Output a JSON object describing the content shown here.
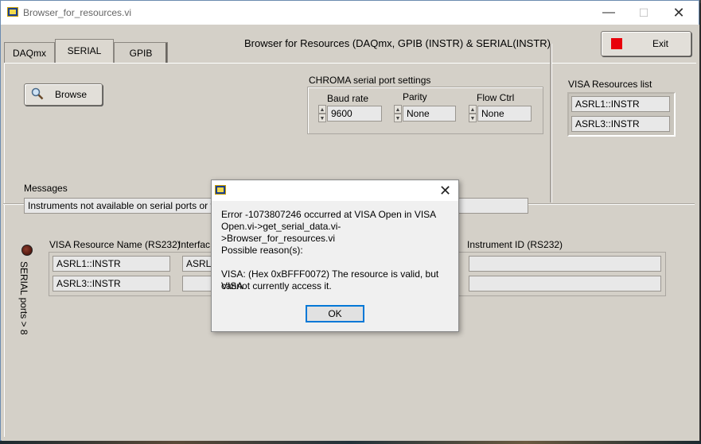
{
  "window": {
    "title": "Browser_for_resources.vi",
    "controls": {
      "minimize": "—",
      "maximize": "☐",
      "close": "✕"
    }
  },
  "header": {
    "title": "Browser for Resources (DAQmx, GPIB (INSTR) & SERIAL(INSTR)",
    "exit_label": "Exit"
  },
  "tabs": [
    {
      "label": "DAQmx",
      "active": false
    },
    {
      "label": "SERIAL",
      "active": true
    },
    {
      "label": "GPIB",
      "active": false
    }
  ],
  "serial": {
    "browse_label": "Browse",
    "chroma": {
      "title": "CHROMA serial port settings",
      "baud_label": "Baud rate",
      "baud_value": "9600",
      "parity_label": "Parity",
      "parity_value": "None",
      "flow_label": "Flow Ctrl",
      "flow_value": "None"
    },
    "visa_list": {
      "title": "VISA Resources list",
      "items": [
        "ASRL1::INSTR",
        "ASRL3::INSTR"
      ]
    },
    "messages": {
      "label": "Messages",
      "value": "Instruments not available on serial ports or t"
    },
    "led_label": "SERIAL ports > 8",
    "table": {
      "col_resource": "VISA Resource Name (RS232)",
      "col_interface": "Interfac",
      "col_instrument": "Instrument ID (RS232)",
      "resources": [
        "ASRL1::INSTR",
        "ASRL3::INSTR"
      ],
      "interfaces": [
        "ASRL1",
        ""
      ],
      "instruments": [
        "",
        ""
      ]
    }
  },
  "dialog": {
    "close": "✕",
    "error_line1": "Error -1073807246 occurred at VISA Open in VISA",
    "error_line2": "Open.vi->get_serial_data.vi->Browser_for_resources.vi",
    "reasons_label": "Possible reason(s):",
    "reason_line1": "VISA:  (Hex 0xBFFF0072) The resource is valid, but VISA",
    "reason_line2": "cannot currently access it.",
    "ok_label": "OK"
  },
  "colors": {
    "exit_indicator": "#e8000b",
    "dialog_focus": "#0078d7",
    "panel_bg": "#d4d0c8"
  }
}
